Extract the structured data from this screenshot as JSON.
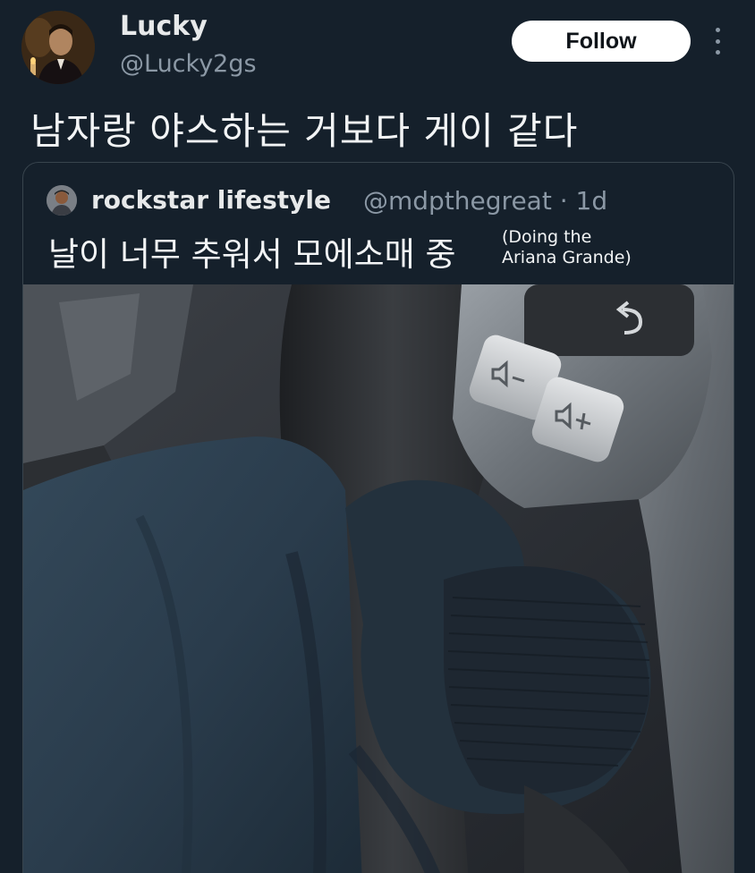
{
  "tweet": {
    "author_name": "Lucky",
    "author_handle": "@Lucky2gs",
    "follow_label": "Follow",
    "text": "남자랑 야스하는 거보다 게이 같다"
  },
  "quoted_tweet": {
    "author_name": "rockstar lifestyle",
    "author_handle": "@mdpthegreat · 1d",
    "text": "날이 너무 추워서 모에소매 중",
    "note_line1": "(Doing the",
    "note_line2": "Ariana Grande)"
  },
  "colors": {
    "background": "#15202b",
    "secondary_text": "#8b98a5",
    "border": "#38444d",
    "follow_button": "#ffffff"
  },
  "icons": {
    "more": "vertical-ellipsis",
    "volume_down": "speaker-minus",
    "volume_up": "speaker-plus",
    "back": "return-arrow"
  }
}
